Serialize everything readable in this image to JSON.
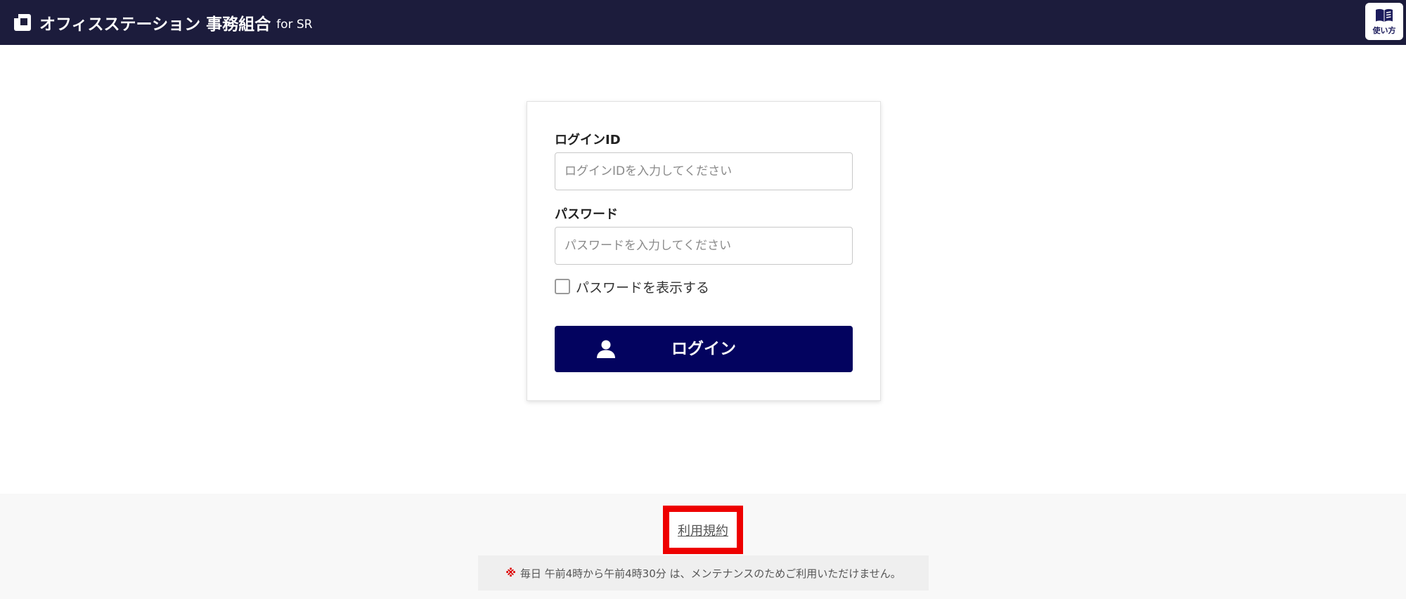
{
  "header": {
    "title": "オフィスステーション 事務組合",
    "subtitle": "for SR",
    "help_label": "使い方",
    "bg_color": "#1c1c3c"
  },
  "login": {
    "id_label": "ログインID",
    "id_placeholder": "ログインIDを入力してください",
    "id_value": "",
    "password_label": "パスワード",
    "password_placeholder": "パスワードを入力してください",
    "password_value": "",
    "show_password_label": "パスワードを表示する",
    "show_password_checked": false,
    "button_label": "ログイン",
    "button_icon": "user-icon",
    "button_color": "#03035f"
  },
  "footer": {
    "terms_link": "利用規約",
    "highlight_color": "#ee0000",
    "notice_mark": "※",
    "notice_text": "毎日 午前4時から午前4時30分 は、メンテナンスのためご利用いただけません。"
  }
}
